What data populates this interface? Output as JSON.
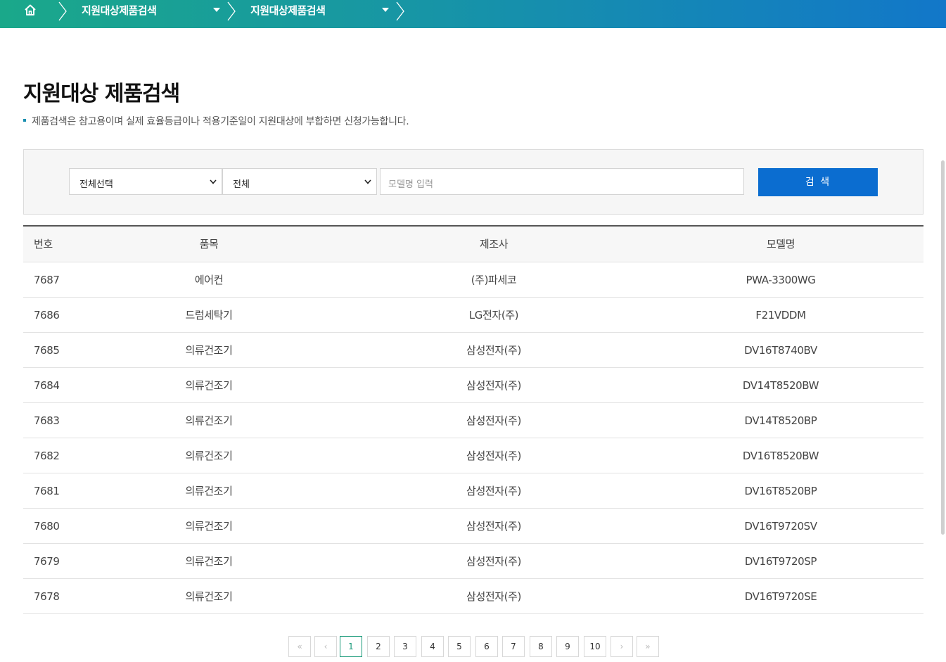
{
  "breadcrumb": {
    "home_icon": "home-icon",
    "items": [
      {
        "label": "지원대상제품검색"
      },
      {
        "label": "지원대상제품검색"
      }
    ]
  },
  "page": {
    "title": "지원대상 제품검색",
    "description": "제품검색은 참고용이며 실제 효율등급이나 적용기준일이 지원대상에 부합하면 신청가능합니다."
  },
  "search": {
    "category_select": "전체선택",
    "subcategory_select": "전체",
    "model_placeholder": "모델명 입력",
    "button_label": "검 색"
  },
  "table": {
    "headers": {
      "no": "번호",
      "category": "품목",
      "manufacturer": "제조사",
      "model": "모델명"
    },
    "rows": [
      {
        "no": "7687",
        "category": "에어컨",
        "manufacturer": "(주)파세코",
        "model": "PWA-3300WG"
      },
      {
        "no": "7686",
        "category": "드럼세탁기",
        "manufacturer": "LG전자(주)",
        "model": "F21VDDM"
      },
      {
        "no": "7685",
        "category": "의류건조기",
        "manufacturer": "삼성전자(주)",
        "model": "DV16T8740BV"
      },
      {
        "no": "7684",
        "category": "의류건조기",
        "manufacturer": "삼성전자(주)",
        "model": "DV14T8520BW"
      },
      {
        "no": "7683",
        "category": "의류건조기",
        "manufacturer": "삼성전자(주)",
        "model": "DV14T8520BP"
      },
      {
        "no": "7682",
        "category": "의류건조기",
        "manufacturer": "삼성전자(주)",
        "model": "DV16T8520BW"
      },
      {
        "no": "7681",
        "category": "의류건조기",
        "manufacturer": "삼성전자(주)",
        "model": "DV16T8520BP"
      },
      {
        "no": "7680",
        "category": "의류건조기",
        "manufacturer": "삼성전자(주)",
        "model": "DV16T9720SV"
      },
      {
        "no": "7679",
        "category": "의류건조기",
        "manufacturer": "삼성전자(주)",
        "model": "DV16T9720SP"
      },
      {
        "no": "7678",
        "category": "의류건조기",
        "manufacturer": "삼성전자(주)",
        "model": "DV16T9720SE"
      }
    ]
  },
  "pagination": {
    "first": "«",
    "prev": "‹",
    "pages": [
      "1",
      "2",
      "3",
      "4",
      "5",
      "6",
      "7",
      "8",
      "9",
      "10"
    ],
    "current": "1",
    "next": "›",
    "last": "»"
  },
  "colors": {
    "accent": "#0b6dd0",
    "active_page": "#1a9a7a"
  }
}
